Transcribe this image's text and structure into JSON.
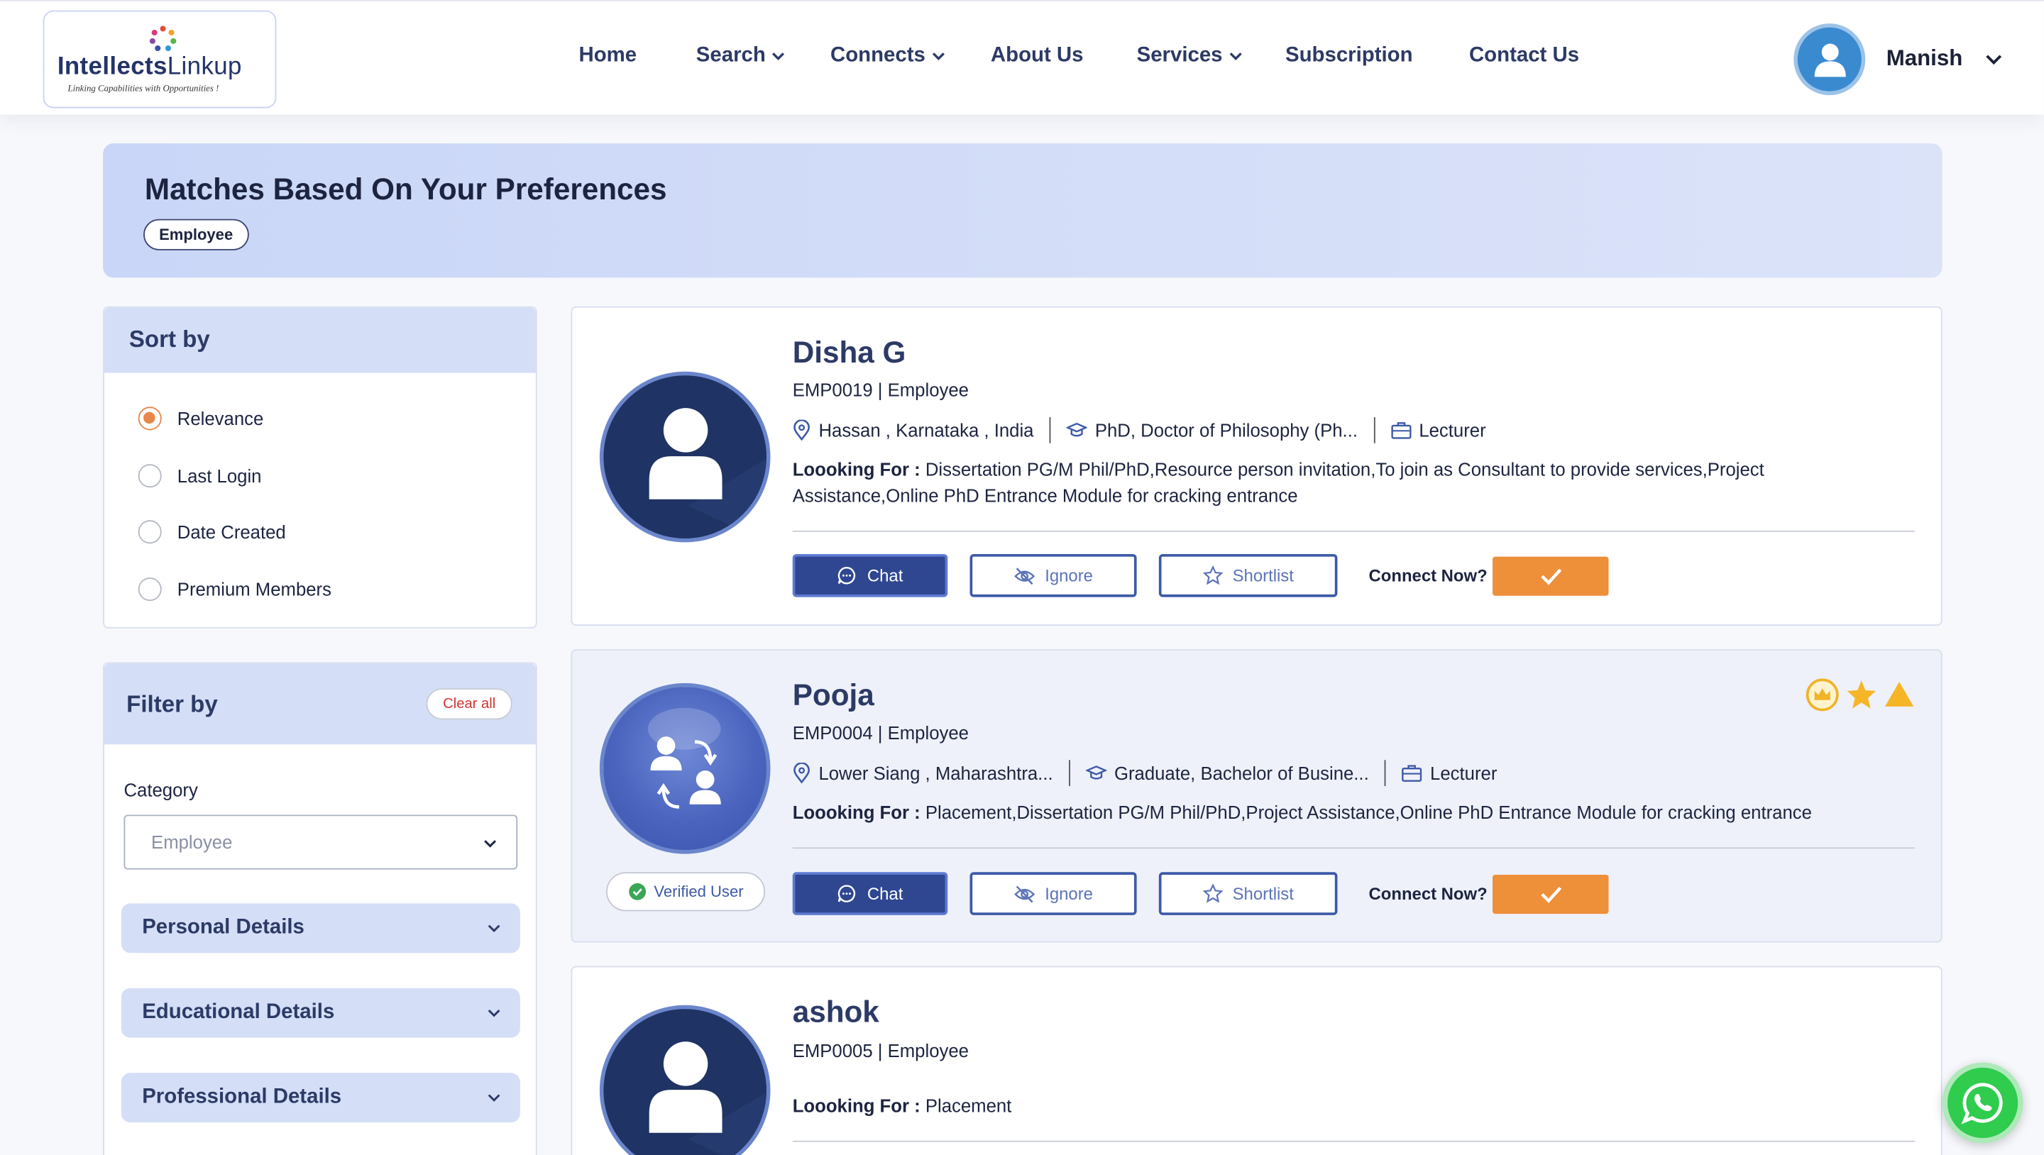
{
  "logo": {
    "brand_bold": "Intellects",
    "brand_light": "Linkup",
    "tagline": "Linking Capabilities with Opportunities !"
  },
  "nav": {
    "home": "Home",
    "search": "Search",
    "connects": "Connects",
    "about": "About Us",
    "services": "Services",
    "subscription": "Subscription",
    "contact": "Contact Us"
  },
  "user": {
    "name": "Manish"
  },
  "banner": {
    "title": "Matches Based On Your Preferences",
    "tag": "Employee"
  },
  "sort": {
    "title": "Sort by",
    "options": [
      "Relevance",
      "Last Login",
      "Date Created",
      "Premium Members"
    ],
    "selected": "Relevance"
  },
  "filter": {
    "title": "Filter by",
    "clear_label": "Clear all",
    "category_label": "Category",
    "category_value": "Employee",
    "sections": [
      "Personal Details",
      "Educational Details",
      "Professional Details"
    ]
  },
  "profiles": [
    {
      "name": "Disha G",
      "id_line": "EMP0019 | Employee",
      "location": "Hassan , Karnataka , India",
      "education": "PhD, Doctor of Philosophy (Ph...",
      "role": "Lecturer",
      "looking_label": "Loooking For :",
      "looking": " Dissertation PG/M Phil/PhD,Resource person invitation,To join as Consultant to provide services,Project Assistance,Online PhD Entrance Module for cracking entrance"
    },
    {
      "name": "Pooja",
      "id_line": "EMP0004 | Employee",
      "location": "Lower Siang , Maharashtra...",
      "education": "Graduate, Bachelor of Busine...",
      "role": "Lecturer",
      "looking_label": "Loooking For :",
      "looking": " Placement,Dissertation PG/M Phil/PhD,Project Assistance,Online PhD Entrance Module for cracking entrance",
      "verified": "Verified User"
    },
    {
      "name": "ashok",
      "id_line": "EMP0005 | Employee",
      "looking_label": "Loooking For :",
      "looking": " Placement"
    }
  ],
  "actions": {
    "chat": "Chat",
    "ignore": "Ignore",
    "shortlist": "Shortlist",
    "connect_prompt": "Connect Now?"
  },
  "colors": {
    "primary": "#2f4791",
    "accent": "#ee8f3a",
    "panel_head": "#d4def7",
    "whatsapp": "#2fcc4e"
  }
}
